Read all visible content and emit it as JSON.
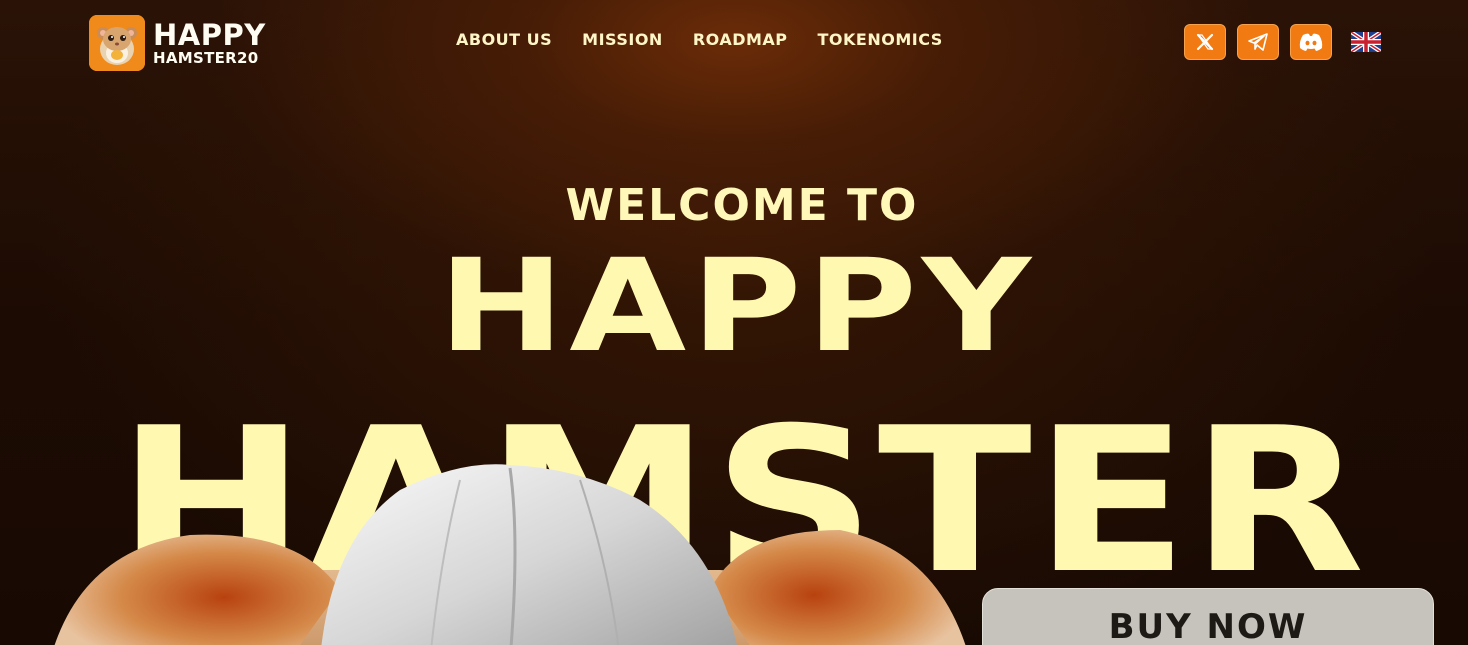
{
  "brand": {
    "line1": "HAPPY",
    "line2": "HAMSTER20",
    "badge_color": "#f08a1a"
  },
  "nav": {
    "items": [
      {
        "label": "ABOUT US"
      },
      {
        "label": "MISSION"
      },
      {
        "label": "ROADMAP"
      },
      {
        "label": "TOKENOMICS"
      }
    ]
  },
  "socials": {
    "items": [
      {
        "icon": "x-twitter-icon"
      },
      {
        "icon": "telegram-icon"
      },
      {
        "icon": "discord-icon"
      }
    ],
    "accent": "#f27a12",
    "language_icon": "uk-flag-icon"
  },
  "hero": {
    "welcome": "WELCOME TO",
    "title_line1": "HAPPY",
    "title_line2": "HAMSTER",
    "text_color": "#fff8b0"
  },
  "cta": {
    "buy_label": "BUY NOW"
  }
}
